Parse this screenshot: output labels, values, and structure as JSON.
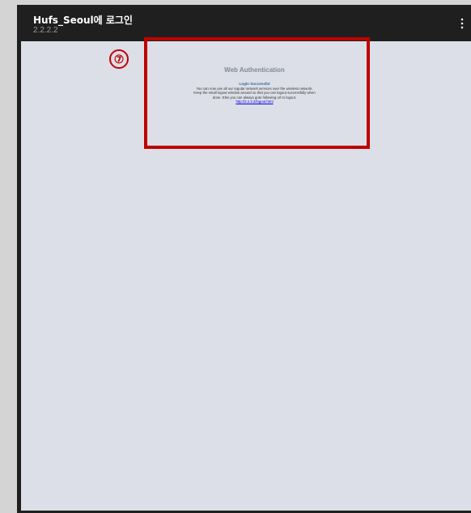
{
  "window": {
    "title": "Hufs_Seoul에 로그인",
    "subtitle": "2.2.2.2",
    "menu_icon": "more-vertical-icon"
  },
  "page": {
    "heading": "Web Authentication",
    "status": "Login Successful",
    "message_lines": [
      "You can now use all our regular network services over the wireless network.",
      "Keep the small logout window around so that you can logout successfully when",
      "done. Else you can always goto following url to logout."
    ],
    "logout_link": "http://2.2.2.2/logout.html"
  },
  "annotation": {
    "step_label": "⑦",
    "highlight_color": "#c00000"
  }
}
